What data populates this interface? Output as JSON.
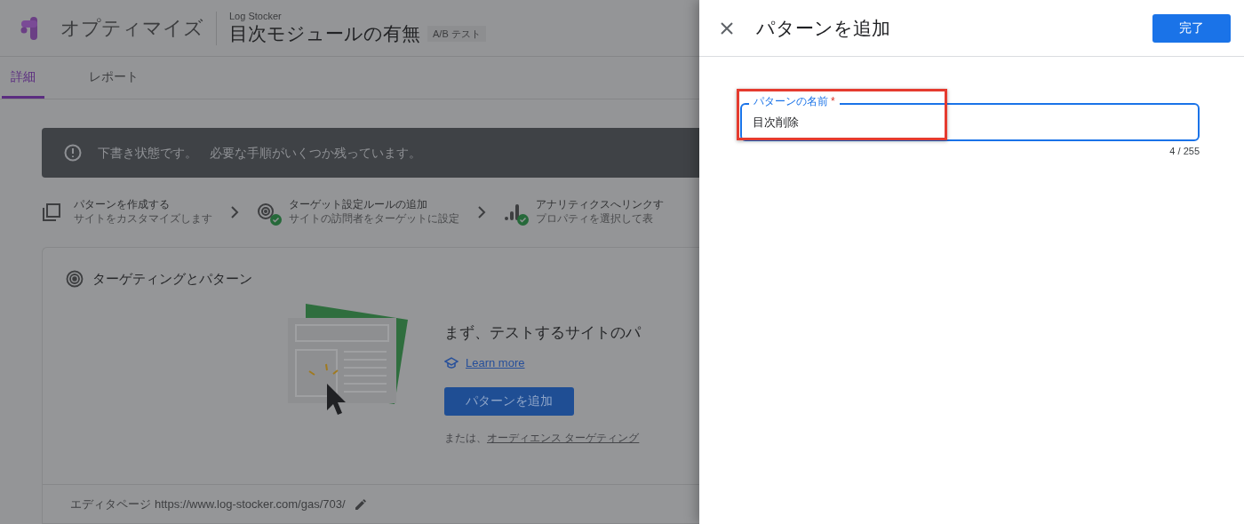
{
  "header": {
    "product": "オプティマイズ",
    "account": "Log Stocker",
    "experiment_title": "目次モジュールの有無",
    "type_badge": "A/B テスト"
  },
  "tabs": [
    {
      "label": "詳細",
      "selected": true
    },
    {
      "label": "レポート",
      "selected": false
    }
  ],
  "banner": {
    "status": "下書き状態です。",
    "message": "必要な手順がいくつか残っています。"
  },
  "steps": [
    {
      "kind": "pages",
      "title": "パターンを作成する",
      "subtitle": "サイトをカスタマイズします",
      "done": false
    },
    {
      "kind": "target",
      "title": "ターゲット設定ルールの追加",
      "subtitle": "サイトの訪問者をターゲットに設定",
      "done": true
    },
    {
      "kind": "analytics",
      "title": "アナリティクスへリンクす",
      "subtitle": "プロパティを選択して表",
      "done": true
    }
  ],
  "card": {
    "title": "ターゲティングとパターン",
    "heading": "まず、テストするサイトのパ",
    "learn_more": "Learn more",
    "add_button": "パターンを追加",
    "alt_prefix": "または、",
    "alt_link": "オーディエンス ターゲティング",
    "footer_label": "エディタページ",
    "footer_url": "https://www.log-stocker.com/gas/703/"
  },
  "drawer": {
    "title": "パターンを追加",
    "done_button": "完了",
    "field": {
      "label": "パターンの名前",
      "required_mark": "*",
      "value": "目次削除",
      "counter": "4 / 255",
      "highlighted": true
    }
  }
}
